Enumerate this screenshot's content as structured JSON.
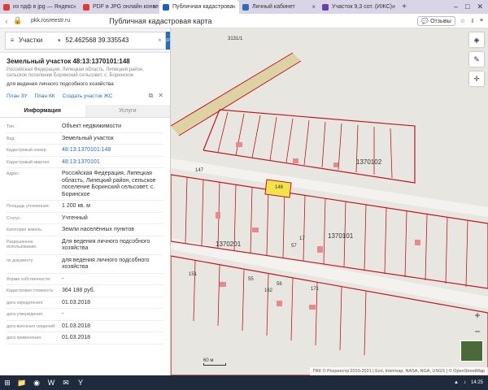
{
  "browser": {
    "tabs": [
      {
        "label": "из пдф в jpg — Яндекс",
        "color": "#e53935"
      },
      {
        "label": "PDF в JPG онлайн конве",
        "color": "#e53935"
      },
      {
        "label": "Публичная кадастрова",
        "color": "#1e5fbf",
        "active": true
      },
      {
        "label": "Личный кабинет",
        "color": "#2a6dbe"
      },
      {
        "label": "Участок 9,3 сот. (ИЖС) -",
        "color": "#6a3fb0"
      }
    ],
    "url": "pkk.rosreestr.ru",
    "page_title": "Публичная кадастровая карта",
    "reviews_label": "Отзывы"
  },
  "search": {
    "type_label": "Участки",
    "value": "52.462568 39.335543"
  },
  "parcel": {
    "title": "Земельный участок 48:13:1370101:148",
    "address_line": "Российская Федерация, Липецкая область, Липецкий район, сельское поселение Боринский сельсовет, с. Боринское",
    "purpose": "для ведения личного подсобного хозяйства",
    "links": [
      "План ЗУ",
      "План КК",
      "Создать участок ЖС"
    ]
  },
  "panel_tabs": [
    "Информация",
    "Услуги"
  ],
  "info_rows": [
    {
      "key": "Тип:",
      "value": "Объект недвижимости"
    },
    {
      "key": "Вид:",
      "value": "Земельный участок"
    },
    {
      "key": "Кадастровый номер:",
      "value": "48:13:1370101:148",
      "link": true
    },
    {
      "key": "Кадастровый квартал:",
      "value": "48:13:1370101",
      "link": true
    },
    {
      "key": "Адрес:",
      "value": "Российская Федерация, Липецкая область, Липецкий район, сельское поселение Боринский сельсовет, с. Боринское"
    },
    {
      "key": "Площадь уточненная:",
      "value": "1 200 кв. м"
    },
    {
      "key": "Статус:",
      "value": "Учтенный"
    },
    {
      "key": "Категория земель:",
      "value": "Земли населённых пунктов"
    },
    {
      "key": "Разрешенное использование:",
      "value": "Для ведения личного подсобного хозяйства"
    },
    {
      "key": "по документу:",
      "value": "для ведения личного подсобного хозяйства"
    },
    {
      "key": "Форма собственности:",
      "value": "-"
    },
    {
      "key": "Кадастровая стоимость:",
      "value": "364 188 руб."
    },
    {
      "key": "дата определения:",
      "value": "01.03.2018"
    },
    {
      "key": "дата утверждения:",
      "value": "-"
    },
    {
      "key": "дата внесения сведений:",
      "value": "01.03.2018"
    },
    {
      "key": "дата применения:",
      "value": "01.03.2018"
    }
  ],
  "map": {
    "labels": {
      "q1": "1370102",
      "q2": "1370101",
      "q3": "1370201",
      "road_top": "3131/1",
      "parcel": "148",
      "a": "147",
      "b": "151",
      "c": "162",
      "d": "171",
      "e": "17",
      "f": "55",
      "g": "56",
      "h": "57"
    },
    "scale_label": "60 м",
    "attribution": "ПКК © Росреестр 2010-2021 | Esri, Intermap, NASA, NGA, USGS | © OpenStreetMap"
  },
  "taskbar": {
    "time": "14:25"
  },
  "colors": {
    "accent": "#2a6dbe",
    "parcel_line": "#c3161c",
    "highlight": "#f4e24a"
  }
}
